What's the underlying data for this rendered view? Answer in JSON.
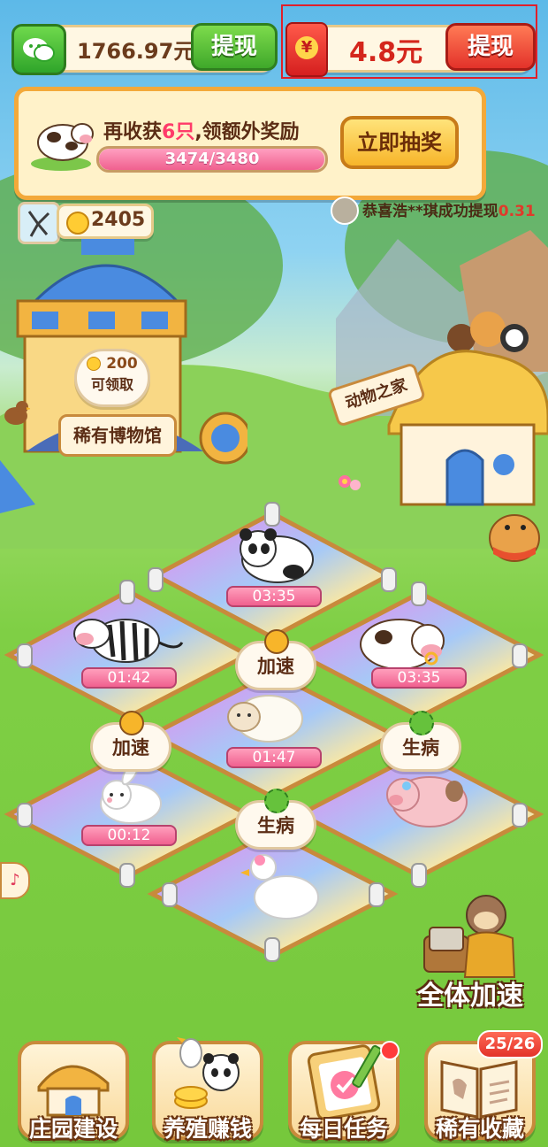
{
  "wallet": {
    "balance": "1766.97元",
    "withdraw_label": "提现"
  },
  "redpacket": {
    "amount": "4.8元",
    "withdraw_label": "提现",
    "icon_symbol": "¥"
  },
  "harvest": {
    "text_prefix": "再收获",
    "count": "6只",
    "text_suffix": ",领额外奖励",
    "progress_text": "3474/3480",
    "progress_fraction": 0.998,
    "lottery_label": "立即抽奖"
  },
  "coins": {
    "amount": "2405"
  },
  "ticker": {
    "text": "恭喜浩**琪成功提现",
    "amount": "0.31"
  },
  "museum": {
    "reward_amount": "200",
    "reward_label": "可领取",
    "sign": "稀有博物馆"
  },
  "animal_home": {
    "sign": "动物之家"
  },
  "pens": [
    {
      "animal": "panda",
      "timer": "03:35"
    },
    {
      "animal": "zebra",
      "timer": "01:42"
    },
    {
      "animal": "cow",
      "timer": "03:35"
    },
    {
      "animal": "sheep",
      "timer": "01:47"
    },
    {
      "animal": "rabbit",
      "timer": "00:12"
    },
    {
      "animal": "pig",
      "timer": ""
    },
    {
      "animal": "duck",
      "timer": ""
    }
  ],
  "status_bubbles": {
    "speedup": "加速",
    "sick": "生病"
  },
  "speed_all": {
    "label": "全体加速"
  },
  "nav": [
    {
      "label": "庄园建设",
      "icon": "house-icon"
    },
    {
      "label": "养殖赚钱",
      "icon": "panda-coins-icon"
    },
    {
      "label": "每日任务",
      "icon": "clipboard-check-icon"
    },
    {
      "label": "稀有收藏",
      "icon": "book-icon",
      "badge": "25/26"
    }
  ],
  "colors": {
    "accent_green": "#3fa82a",
    "accent_red": "#e3322a",
    "highlight_box": "#e0202a",
    "grass": "#7fcf45"
  }
}
